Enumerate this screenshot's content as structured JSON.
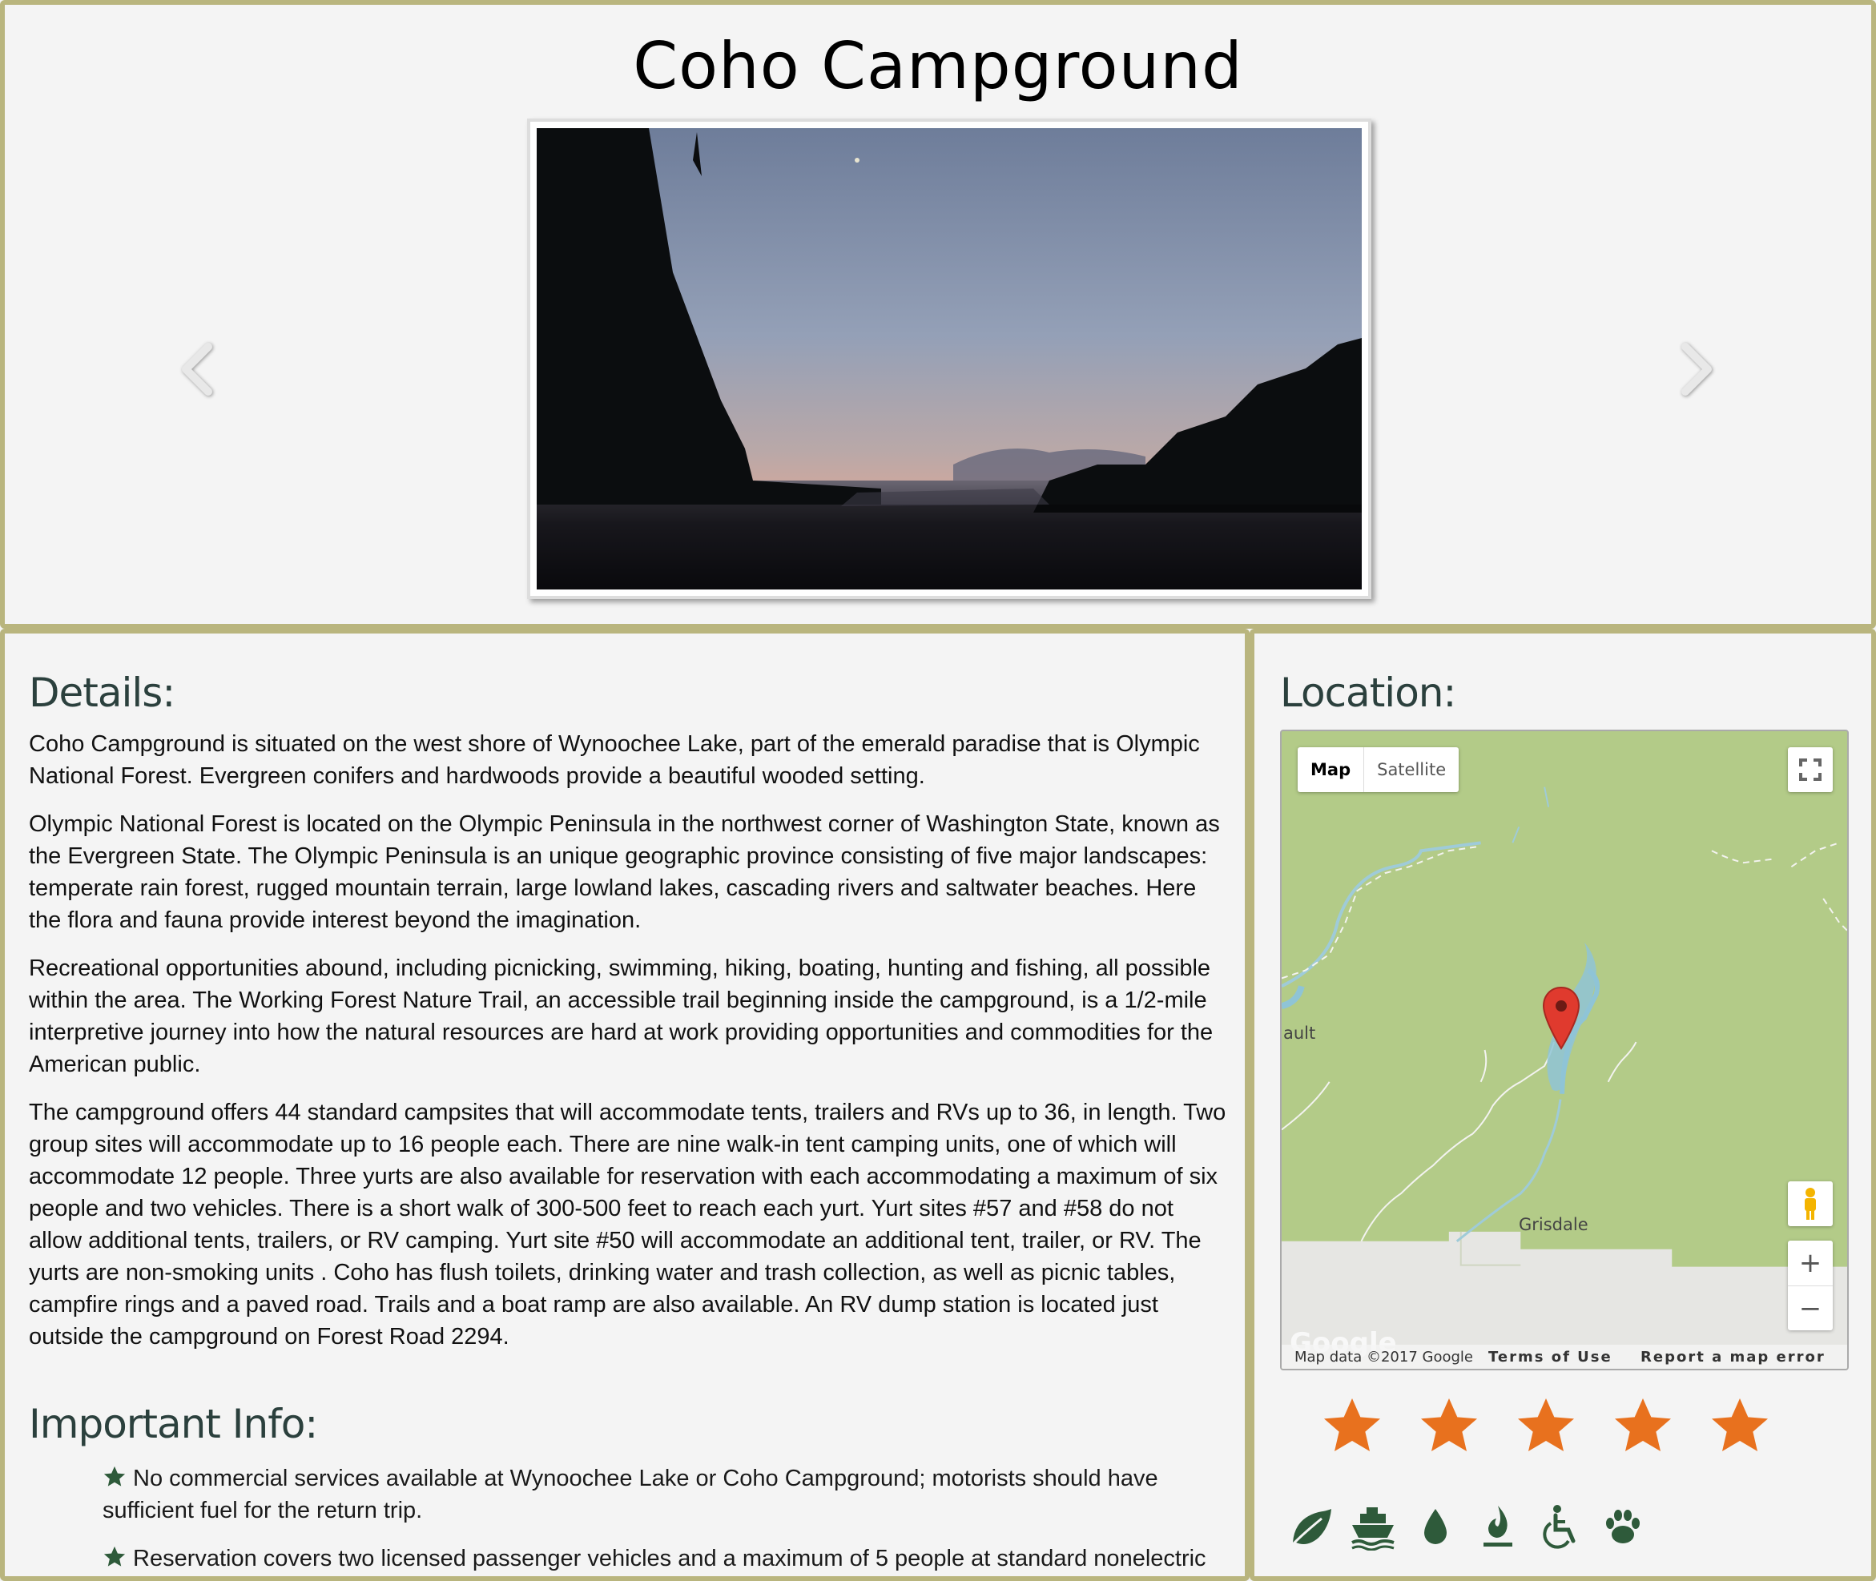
{
  "page": {
    "title": "Coho Campground"
  },
  "carousel": {
    "prev_icon": "chevron-left-icon",
    "next_icon": "chevron-right-icon"
  },
  "details": {
    "heading": "Details:",
    "paragraphs": [
      "Coho Campground is situated on the west shore of Wynoochee Lake, part of the emerald paradise that is Olympic National Forest. Evergreen conifers and hardwoods provide a beautiful wooded setting.",
      "Olympic National Forest is located on the Olympic Peninsula in the northwest corner of Washington State, known as the Evergreen State. The Olympic Peninsula is an unique geographic province consisting of five major landscapes: temperate rain forest, rugged mountain terrain, large lowland lakes, cascading rivers and saltwater beaches. Here the flora and fauna provide interest beyond the imagination.",
      "Recreational opportunities abound, including picnicking, swimming, hiking, boating, hunting and fishing, all possible within the area. The Working Forest Nature Trail, an accessible trail beginning inside the campground, is a 1/2-mile interpretive journey into how the natural resources are hard at work providing opportunities and commodities for the American public.",
      "The campground offers 44 standard campsites that will accommodate tents, trailers and RVs up to 36, in length. Two group sites will accommodate up to 16 people each. There are nine walk-in tent camping units, one of which will accommodate 12 people. Three yurts are also available for reservation with each accommodating a maximum of six people and two vehicles. There is a short walk of 300-500 feet to reach each yurt. Yurt sites #57 and #58 do not allow additional tents, trailers, or RV camping. Yurt site #50 will accommodate an additional tent, trailer, or RV. The yurts are non-smoking units . Coho has flush toilets, drinking water and trash collection, as well as picnic tables, campfire rings and a paved road. Trails and a boat ramp are also available. An RV dump station is located just outside the campground on Forest Road 2294."
    ]
  },
  "important": {
    "heading": "Important Info:",
    "items": [
      "No commercial services available at Wynoochee Lake or Coho Campground; motorists should have sufficient fuel for the return trip.",
      "Reservation covers two licensed passenger vehicles and a maximum of 5 people at standard nonelectric sites;"
    ]
  },
  "location": {
    "heading": "Location:",
    "map": {
      "type_map": "Map",
      "type_satellite": "Satellite",
      "place_label_1": "ault",
      "place_label_2": "Grisdale",
      "zoom_in": "+",
      "zoom_out": "−",
      "logo": "Google",
      "map_data": "Map data ©2017 Google",
      "terms": "Terms of Use",
      "report": "Report a map error",
      "land_color": "#b3cb88",
      "water_color": "#8fc4d6",
      "marker_color": "#e03a2e"
    }
  },
  "rating": {
    "stars": 5,
    "max": 5,
    "star_color": "#e8711e"
  },
  "amenities": [
    {
      "icon": "leaf-icon"
    },
    {
      "icon": "boat-icon"
    },
    {
      "icon": "water-drop-icon"
    },
    {
      "icon": "campfire-icon"
    },
    {
      "icon": "wheelchair-icon"
    },
    {
      "icon": "paw-icon"
    }
  ],
  "colors": {
    "panel_border": "#b9b57e",
    "heading": "#2b403d",
    "amenity_icon": "#2e5a3a",
    "bullet_star": "#2e5a3a"
  }
}
